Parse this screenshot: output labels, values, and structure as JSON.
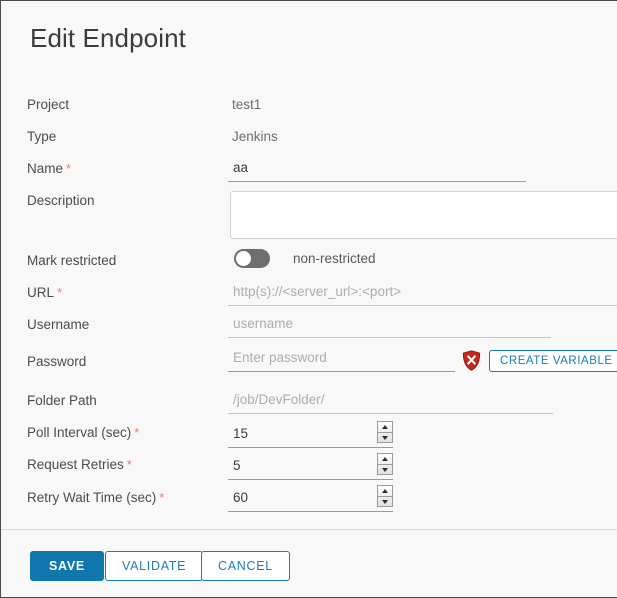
{
  "window": {
    "title": "Edit Endpoint"
  },
  "form": {
    "project": {
      "label": "Project",
      "value": "test1"
    },
    "type": {
      "label": "Type",
      "value": "Jenkins"
    },
    "name": {
      "label": "Name",
      "required": "*",
      "value": "aa"
    },
    "description": {
      "label": "Description",
      "value": ""
    },
    "mark_restricted": {
      "label": "Mark restricted",
      "state_text": "non-restricted",
      "enabled": false
    },
    "url": {
      "label": "URL",
      "required": "*",
      "value": "",
      "placeholder": "http(s)://<server_url>:<port>"
    },
    "username": {
      "label": "Username",
      "value": "",
      "placeholder": "username"
    },
    "password": {
      "label": "Password",
      "value": "",
      "placeholder": "Enter password",
      "error_icon": "shield-error-icon",
      "create_variable_label": "CREATE VARIABLE"
    },
    "folder_path": {
      "label": "Folder Path",
      "value": "",
      "placeholder": "/job/DevFolder/"
    },
    "poll_interval": {
      "label": "Poll Interval (sec)",
      "required": "*",
      "value": "15"
    },
    "request_retries": {
      "label": "Request Retries",
      "required": "*",
      "value": "5"
    },
    "retry_wait_time": {
      "label": "Retry Wait Time (sec)",
      "required": "*",
      "value": "60"
    }
  },
  "footer": {
    "save_label": "SAVE",
    "validate_label": "VALIDATE",
    "cancel_label": "CANCEL"
  },
  "colors": {
    "accent": "#0f76ae",
    "link": "#1a7bb9",
    "required": "#e8826a",
    "error": "#c4281c",
    "background": "#f8f8f8"
  }
}
